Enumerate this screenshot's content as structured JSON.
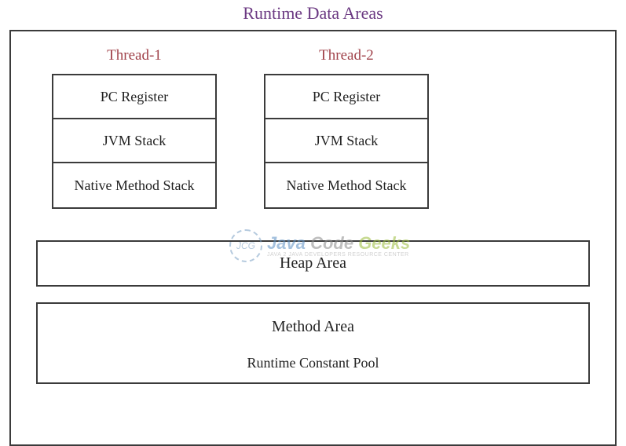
{
  "title": "Runtime Data Areas",
  "threads": [
    {
      "label": "Thread-1",
      "cells": [
        "PC Register",
        "JVM Stack",
        "Native Method Stack"
      ]
    },
    {
      "label": "Thread-2",
      "cells": [
        "PC Register",
        "JVM Stack",
        "Native Method Stack"
      ]
    }
  ],
  "heap": {
    "title": "Heap Area"
  },
  "method_area": {
    "title": "Method Area",
    "sub": "Runtime Constant Pool"
  },
  "watermark": {
    "logo": "JCG",
    "java": "Java ",
    "code": "Code ",
    "geeks": "Geeks",
    "tagline": "JAVA 2 JAVA DEVELOPERS RESOURCE CENTER"
  }
}
